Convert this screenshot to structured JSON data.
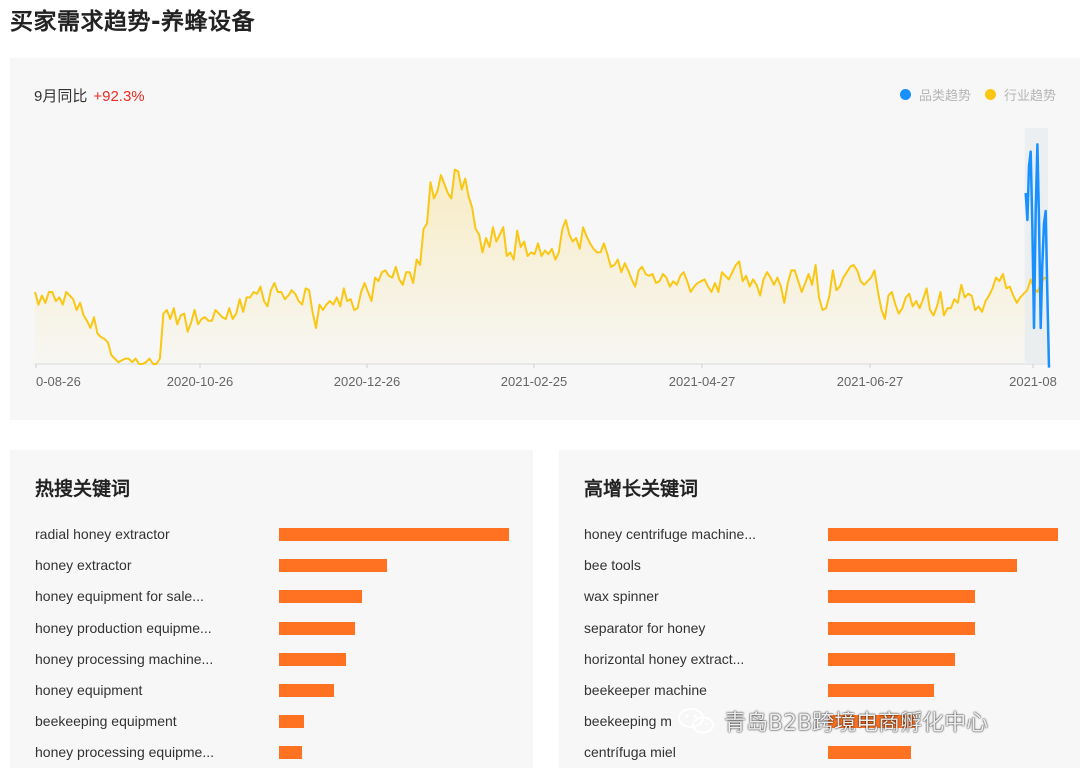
{
  "page": {
    "title": "买家需求趋势-养蜂设备"
  },
  "trend": {
    "yoy_label": "9月同比",
    "yoy_value": "+92.3%",
    "legend": [
      {
        "label": "品类趋势",
        "color": "#1890ff"
      },
      {
        "label": "行业趋势",
        "color": "#fac715"
      }
    ],
    "x_ticks": [
      "0-08-26",
      "2020-10-26",
      "2020-12-26",
      "2021-02-25",
      "2021-04-27",
      "2021-06-27",
      "2021-08"
    ]
  },
  "chart_data": {
    "type": "line",
    "x_start": "2020-08-26",
    "x_end": "2021-08-31",
    "series": [
      {
        "name": "行业趋势",
        "color": "#fac715",
        "values": [
          40,
          33,
          38,
          34,
          40,
          40,
          35,
          37,
          33,
          40,
          38,
          36,
          30,
          34,
          27,
          24,
          20,
          26,
          17,
          15,
          14,
          12,
          5,
          3,
          1,
          2,
          3,
          3,
          1,
          3,
          0,
          0,
          1,
          3,
          0,
          0,
          3,
          28,
          30,
          25,
          31,
          22,
          27,
          28,
          18,
          23,
          30,
          22,
          25,
          26,
          24,
          24,
          30,
          28,
          26,
          25,
          31,
          25,
          28,
          36,
          29,
          37,
          37,
          40,
          39,
          43,
          35,
          32,
          41,
          45,
          40,
          40,
          36,
          38,
          41,
          39,
          35,
          33,
          42,
          41,
          29,
          20,
          33,
          30,
          33,
          35,
          33,
          37,
          32,
          42,
          35,
          36,
          30,
          31,
          40,
          45,
          40,
          35,
          48,
          46,
          51,
          52,
          49,
          48,
          54,
          47,
          44,
          51,
          51,
          45,
          58,
          55,
          75,
          78,
          101,
          92,
          96,
          105,
          100,
          95,
          92,
          108,
          107,
          97,
          103,
          93,
          87,
          75,
          72,
          62,
          70,
          65,
          76,
          68,
          72,
          76,
          60,
          62,
          58,
          74,
          65,
          68,
          60,
          62,
          61,
          67,
          60,
          63,
          61,
          64,
          58,
          62,
          75,
          80,
          72,
          68,
          70,
          64,
          76,
          71,
          67,
          64,
          62,
          62,
          67,
          61,
          54,
          55,
          58,
          51,
          56,
          52,
          47,
          43,
          52,
          54,
          50,
          49,
          50,
          45,
          46,
          50,
          48,
          43,
          46,
          44,
          49,
          51,
          46,
          40,
          43,
          45,
          46,
          47,
          43,
          40,
          45,
          40,
          51,
          49,
          47,
          51,
          55,
          57,
          46,
          49,
          43,
          47,
          44,
          38,
          47,
          51,
          48,
          44,
          48,
          43,
          34,
          45,
          52,
          52,
          46,
          40,
          45,
          50,
          44,
          55,
          37,
          30,
          31,
          38,
          52,
          41,
          43,
          48,
          51,
          54,
          55,
          52,
          46,
          44,
          46,
          48,
          52,
          40,
          30,
          25,
          38,
          40,
          33,
          28,
          31,
          37,
          39,
          32,
          35,
          31,
          36,
          42,
          30,
          27,
          32,
          40,
          27,
          31,
          31,
          36,
          34,
          44,
          37,
          39,
          38,
          30,
          32,
          29,
          35,
          38,
          42,
          48,
          46,
          50,
          42,
          43,
          38,
          34,
          37,
          39,
          41,
          47,
          42,
          40,
          45,
          48,
          47
        ]
      },
      {
        "name": "品类趋势",
        "color": "#1890ff",
        "values": [
          95,
          80,
          110,
          118,
          75,
          20,
          85,
          122,
          80,
          20,
          55,
          78,
          85,
          40,
          -2
        ]
      }
    ],
    "ylim": [
      0,
      130
    ],
    "grid": false,
    "legend_position": "top-right"
  },
  "hot_keywords": {
    "title": "热搜关键词",
    "items": [
      {
        "label": "radial honey extractor",
        "value": 100
      },
      {
        "label": "honey extractor",
        "value": 47
      },
      {
        "label": "honey equipment for sale...",
        "value": 36
      },
      {
        "label": "honey production equipme...",
        "value": 33
      },
      {
        "label": "honey processing machine...",
        "value": 29
      },
      {
        "label": "honey equipment",
        "value": 24
      },
      {
        "label": "beekeeping equipment",
        "value": 11
      },
      {
        "label": "honey processing equipme...",
        "value": 10
      }
    ]
  },
  "growth_keywords": {
    "title": "高增长关键词",
    "items": [
      {
        "label": "honey centrifuge machine...",
        "value": 100
      },
      {
        "label": "bee tools",
        "value": 82
      },
      {
        "label": "wax spinner",
        "value": 64
      },
      {
        "label": "separator for honey",
        "value": 64
      },
      {
        "label": "horizontal honey extract...",
        "value": 55
      },
      {
        "label": "beekeeper machine",
        "value": 46
      },
      {
        "label": "beekeeping m",
        "value": 38
      },
      {
        "label": "centrífuga miel",
        "value": 36
      }
    ]
  },
  "watermark": {
    "text": "青岛B2B跨境电商孵化中心",
    "icon": "wechat-icon"
  }
}
